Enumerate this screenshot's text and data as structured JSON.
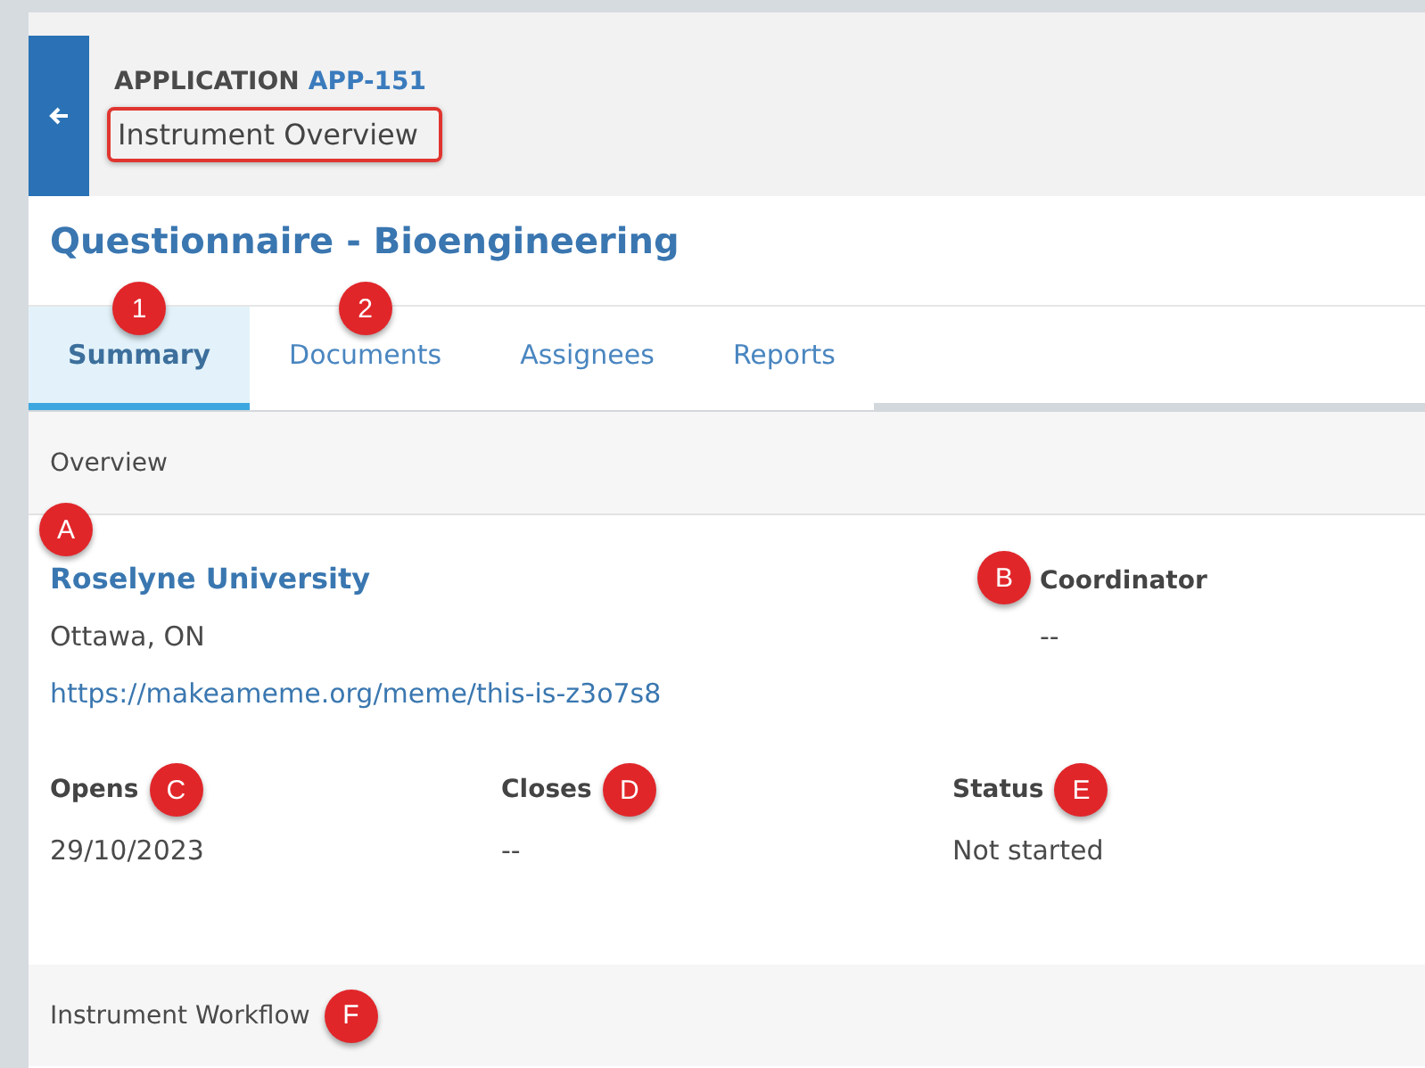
{
  "header": {
    "eyebrow": "APPLICATION",
    "app_id": "APP-151",
    "subtitle": "Instrument Overview",
    "subtitle_highlighted": true
  },
  "title": "Questionnaire - Bioengineering",
  "tabs": [
    {
      "label": "Summary",
      "selected": true,
      "marker": "1"
    },
    {
      "label": "Documents",
      "selected": false,
      "marker": "2"
    },
    {
      "label": "Assignees",
      "selected": false
    },
    {
      "label": "Reports",
      "selected": false
    }
  ],
  "overview": {
    "heading": "Overview",
    "organization": {
      "name": "Roselyne University",
      "marker": "A",
      "location": "Ottawa, ON",
      "url": "https://makeameme.org/meme/this-is-z3o7s8"
    },
    "coordinator": {
      "label": "Coordinator",
      "marker": "B",
      "value": "--"
    },
    "fields": [
      {
        "label": "Opens",
        "marker": "C",
        "value": "29/10/2023"
      },
      {
        "label": "Closes",
        "marker": "D",
        "value": "--"
      },
      {
        "label": "Status",
        "marker": "E",
        "value": "Not started"
      }
    ]
  },
  "workflow": {
    "heading": "Instrument Workflow",
    "marker": "F"
  }
}
